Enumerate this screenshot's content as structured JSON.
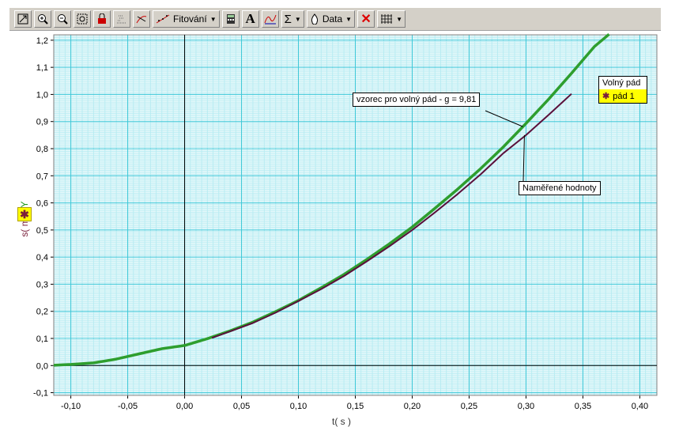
{
  "toolbar": {
    "fit_label": "Fitování",
    "data_label": "Data",
    "icons": [
      "autoscale-icon",
      "zoom-in-icon",
      "zoom-out-icon",
      "zoom-box-icon",
      "lock-icon",
      "stats-icon",
      "tangent-icon",
      "fit-icon",
      "calculator-icon",
      "text-A-icon",
      "function-icon",
      "sigma-icon",
      "data-icon",
      "delete-icon",
      "grid-icon"
    ]
  },
  "chart_data": {
    "type": "line",
    "title": "",
    "xlabel": "t( s )",
    "ylabel": "s( m )",
    "ylabel_suffix": ", Y",
    "xlim": [
      -0.115,
      0.415
    ],
    "ylim": [
      -0.11,
      1.22
    ],
    "xticks": [
      "-0,10",
      "-0,05",
      "0,00",
      "0,05",
      "0,10",
      "0,15",
      "0,20",
      "0,25",
      "0,30",
      "0,35",
      "0,40"
    ],
    "xtick_values": [
      -0.1,
      -0.05,
      0.0,
      0.05,
      0.1,
      0.15,
      0.2,
      0.25,
      0.3,
      0.35,
      0.4
    ],
    "yticks": [
      "-0,1",
      "0,0",
      "0,1",
      "0,2",
      "0,3",
      "0,4",
      "0,5",
      "0,6",
      "0,7",
      "0,8",
      "0,9",
      "1,0",
      "1,1",
      "1,2"
    ],
    "ytick_values": [
      -0.1,
      0.0,
      0.1,
      0.2,
      0.3,
      0.4,
      0.5,
      0.6,
      0.7,
      0.8,
      0.9,
      1.0,
      1.1,
      1.2
    ],
    "grid": true,
    "colors": {
      "grid_major": "#3ec8d8",
      "grid_minor": "#b8ecf2",
      "model": "#2e9e2e",
      "measured": "#5a0f3a",
      "axis": "#000000"
    },
    "series": [
      {
        "name": "vzorec pro volný pád - g = 9,81",
        "style": "model",
        "x": [
          -0.115,
          -0.1,
          -0.08,
          -0.06,
          -0.04,
          -0.02,
          0.0,
          0.02,
          0.04,
          0.06,
          0.08,
          0.1,
          0.12,
          0.14,
          0.16,
          0.18,
          0.2,
          0.22,
          0.24,
          0.26,
          0.28,
          0.3,
          0.32,
          0.34,
          0.36,
          0.373
        ],
        "y": [
          0.001,
          0.004,
          0.01,
          0.024,
          0.043,
          0.062,
          0.074,
          0.099,
          0.128,
          0.16,
          0.199,
          0.24,
          0.287,
          0.336,
          0.391,
          0.449,
          0.511,
          0.58,
          0.651,
          0.726,
          0.806,
          0.893,
          0.983,
          1.078,
          1.176,
          1.222
        ]
      },
      {
        "name": "pád 1",
        "style": "measured",
        "x": [
          0.024,
          0.04,
          0.06,
          0.08,
          0.1,
          0.12,
          0.14,
          0.16,
          0.18,
          0.2,
          0.22,
          0.24,
          0.26,
          0.28,
          0.3,
          0.32,
          0.34
        ],
        "y": [
          0.102,
          0.126,
          0.157,
          0.195,
          0.238,
          0.282,
          0.33,
          0.384,
          0.44,
          0.5,
          0.565,
          0.633,
          0.705,
          0.783,
          0.85,
          0.925,
          1.002
        ]
      }
    ],
    "legend": {
      "title": "Volný pád",
      "items": [
        "pád 1"
      ],
      "position": "right"
    },
    "annotations": [
      "vzorec pro volný pád - g = 9,81",
      "Naměřené hodnoty"
    ]
  }
}
